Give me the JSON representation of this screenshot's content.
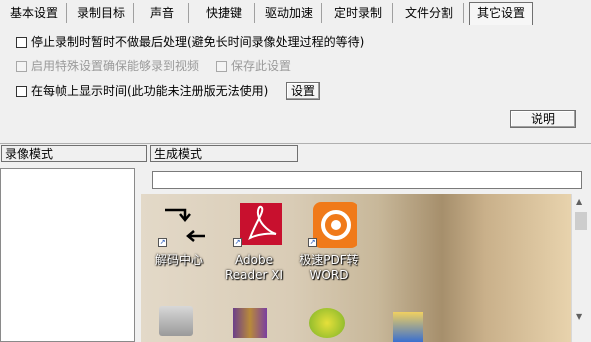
{
  "tabs": [
    {
      "label": "基本设置"
    },
    {
      "label": "录制目标"
    },
    {
      "label": "声音"
    },
    {
      "label": "快捷键"
    },
    {
      "label": "驱动加速"
    },
    {
      "label": "定时录制"
    },
    {
      "label": "文件分割"
    },
    {
      "label": "其它设置"
    }
  ],
  "options": {
    "no_post_process": "停止录制时暂时不做最后处理(避免长时间录像处理过程的等待)",
    "special_settings": "启用特殊设置确保能够录到视频",
    "save_settings": "保存此设置",
    "show_time": "在每帧上显示时间(此功能未注册版无法使用)",
    "settings_button": "设置",
    "explain_button": "说明"
  },
  "bottom_tabs": {
    "record_mode": "录像模式",
    "generate_mode": "生成模式"
  },
  "desktop_icons": [
    {
      "label": "解码中心"
    },
    {
      "label": "Adobe\nReader XI"
    },
    {
      "label": "极速PDF转\nWORD"
    }
  ],
  "scrollbar": {
    "up": "▲",
    "down": "▼"
  },
  "colors": {
    "adobe_red": "#c8102e",
    "pdf_orange": "#f07a1a"
  }
}
